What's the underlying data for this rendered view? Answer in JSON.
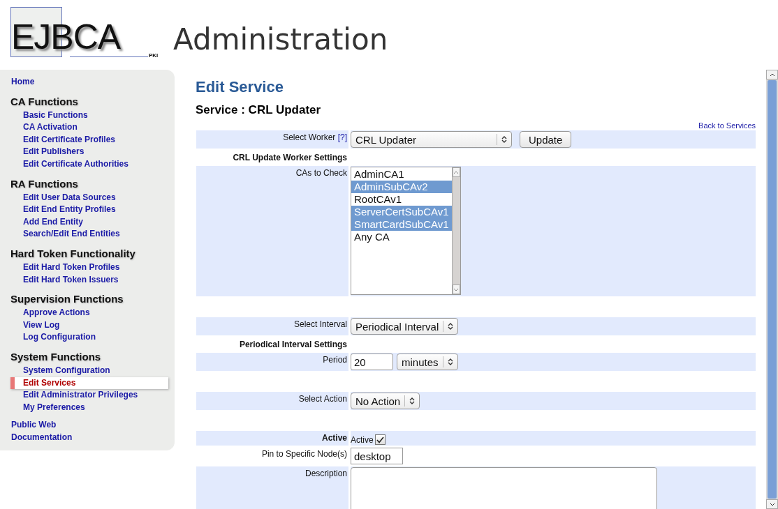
{
  "header": {
    "logo": "EJBCA",
    "logo_suffix": "PKI",
    "title": "Administration"
  },
  "nav": {
    "items": [
      {
        "kind": "link",
        "label": "Home",
        "selected": false
      },
      {
        "kind": "section",
        "label": "CA Functions",
        "children": [
          {
            "label": "Basic Functions",
            "selected": false
          },
          {
            "label": "CA Activation",
            "selected": false
          },
          {
            "label": "Edit Certificate Profiles",
            "selected": false
          },
          {
            "label": "Edit Publishers",
            "selected": false
          },
          {
            "label": "Edit Certificate Authorities",
            "selected": false
          }
        ]
      },
      {
        "kind": "section",
        "label": "RA Functions",
        "children": [
          {
            "label": "Edit User Data Sources",
            "selected": false
          },
          {
            "label": "Edit End Entity Profiles",
            "selected": false
          },
          {
            "label": "Add End Entity",
            "selected": false
          },
          {
            "label": "Search/Edit End Entities",
            "selected": false
          }
        ]
      },
      {
        "kind": "section",
        "label": "Hard Token Functionality",
        "children": [
          {
            "label": "Edit Hard Token Profiles",
            "selected": false
          },
          {
            "label": "Edit Hard Token Issuers",
            "selected": false
          }
        ]
      },
      {
        "kind": "section",
        "label": "Supervision Functions",
        "children": [
          {
            "label": "Approve Actions",
            "selected": false
          },
          {
            "label": "View Log",
            "selected": false
          },
          {
            "label": "Log Configuration",
            "selected": false
          }
        ]
      },
      {
        "kind": "section",
        "label": "System Functions",
        "children": [
          {
            "label": "System Configuration",
            "selected": false
          },
          {
            "label": "Edit Services",
            "selected": true
          },
          {
            "label": "Edit Administrator Privileges",
            "selected": false
          },
          {
            "label": "My Preferences",
            "selected": false
          }
        ]
      },
      {
        "kind": "link",
        "label": "Public Web",
        "selected": false
      },
      {
        "kind": "link",
        "label": "Documentation",
        "selected": false
      }
    ]
  },
  "page": {
    "title": "Edit Service",
    "subtitle": "Service : CRL Updater",
    "back_link": "Back to Services"
  },
  "form": {
    "rows": [
      {
        "kind": "select",
        "shaded": true,
        "label": "Select Worker",
        "help": "[?]",
        "value": "CRL Updater",
        "button": "Update"
      },
      {
        "kind": "section",
        "shaded": false,
        "label": "CRL Update Worker Settings"
      },
      {
        "kind": "listbox",
        "shaded": true,
        "label": "CAs to Check",
        "options": [
          {
            "label": "AdminCA1",
            "selected": false
          },
          {
            "label": "AdminSubCAv2",
            "selected": true
          },
          {
            "label": "RootCAv1",
            "selected": false
          },
          {
            "label": "ServerCertSubCAv1",
            "selected": true
          },
          {
            "label": "SmartCardSubCAv1",
            "selected": true
          },
          {
            "label": "Any CA",
            "selected": false
          }
        ]
      },
      {
        "kind": "spacer",
        "shaded": false
      },
      {
        "kind": "select",
        "shaded": true,
        "label": "Select Interval",
        "value": "Periodical Interval"
      },
      {
        "kind": "section",
        "shaded": false,
        "label": "Periodical Interval Settings"
      },
      {
        "kind": "input-select",
        "shaded": true,
        "label": "Period",
        "value": "20",
        "unit": "minutes"
      },
      {
        "kind": "spacer",
        "shaded": false
      },
      {
        "kind": "select",
        "shaded": true,
        "label": "Select Action",
        "value": "No Action"
      },
      {
        "kind": "spacer",
        "shaded": false
      },
      {
        "kind": "checkbox",
        "shaded": true,
        "label": "Active",
        "checkbox_label": "Active",
        "checked": true
      },
      {
        "kind": "input",
        "shaded": false,
        "label": "Pin to Specific Node(s)",
        "value": "desktop"
      },
      {
        "kind": "textarea",
        "shaded": true,
        "label": "Description",
        "value": ""
      }
    ]
  }
}
